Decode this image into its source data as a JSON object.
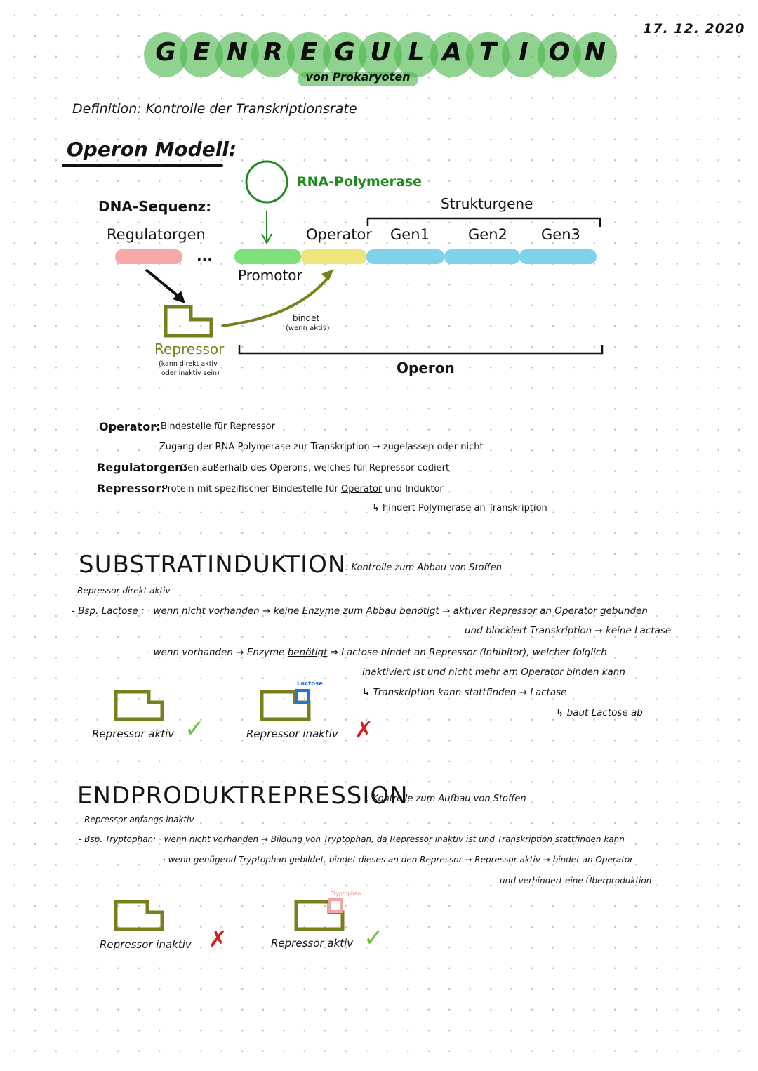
{
  "date": "17. 12. 2020",
  "title": {
    "letters": [
      "G",
      "E",
      "N",
      "R",
      "E",
      "G",
      "U",
      "L",
      "A",
      "T",
      "I",
      "O",
      "N"
    ],
    "subtitle": "von Prokaryoten",
    "accent_color": "#4cb64c"
  },
  "definition": "Definition: Kontrolle der Transkriptionsrate",
  "operon_model": {
    "heading": "Operon Modell:",
    "dna_label": "DNA-Sequenz:",
    "rna_polymerase": "RNA-Polymerase",
    "strukturgene": "Strukturgene",
    "segments": [
      {
        "label": "Regulatorgen",
        "color": "#f7a9a9"
      },
      {
        "label": "Promotor",
        "color": "#7ee07a"
      },
      {
        "label": "Operator",
        "color": "#ede57a"
      },
      {
        "label": "Gen1",
        "color": "#7ed2ea"
      },
      {
        "label": "Gen2",
        "color": "#7ed2ea"
      },
      {
        "label": "Gen3",
        "color": "#7ed2ea"
      }
    ],
    "ellipsis": "...",
    "bindet": "bindet",
    "wenn_aktiv": "(wenn aktiv)",
    "repressor": "Repressor",
    "repressor_note_1": "(kann direkt aktiv",
    "repressor_note_2": "oder inaktiv sein)",
    "operon": "Operon",
    "repressor_color": "#7a7f1b"
  },
  "glossary": {
    "operator_key": "Operator:",
    "operator_line1": "- Bindestelle für Repressor",
    "operator_line2": "- Zugang der RNA-Polymerase zur Transkription → zugelassen oder nicht",
    "regulatorgen_key": "Regulatorgen:",
    "regulatorgen_text": "Gen außerhalb des Operons, welches für Repressor codiert",
    "repressor_key": "Repressor:",
    "repressor_text_a": "Protein mit spezifischer Bindestelle für",
    "repressor_text_operator": "Operator",
    "repressor_text_b": "und Induktor",
    "repressor_sub": "↳ hindert Polymerase an Transkription"
  },
  "substratinduktion": {
    "title": "SUBSTRATINDUKTION",
    "subtitle": ": Kontrolle zum Abbau von Stoffen",
    "line1": "- Repressor direkt aktiv",
    "line2_a": "- Bsp. Lactose :  · wenn nicht vorhanden →",
    "line2_keine": "keine",
    "line2_b": "Enzyme zum Abbau benötigt ⇒ aktiver Repressor an Operator gebunden",
    "line3": "und blockiert Transkription → keine Lactase",
    "line4_a": "· wenn vorhanden → Enzyme",
    "line4_benoetigt": "benötigt",
    "line4_b": "⇒  Lactose bindet an Repressor (Inhibitor), welcher folglich",
    "line5": "inaktiviert ist und nicht mehr am Operator binden kann",
    "line6": "↳ Transkription kann stattfinden → Lactase",
    "line7": "↳ baut Lactose ab",
    "lactose_tag": "Lactose",
    "caption_active": "Repressor aktiv",
    "caption_inactive": "Repressor inaktiv",
    "check": "✓",
    "cross": "✗",
    "lactose_color": "#2476d6"
  },
  "endproduktrepression": {
    "title": "ENDPRODUKTREPRESSION",
    "subtitle": ": Kontrolle zum Aufbau von Stoffen",
    "line1": "- Repressor anfangs inaktiv",
    "line2": "- Bsp. Tryptophan:  · wenn nicht vorhanden → Bildung von Tryptophan, da Repressor inaktiv ist und Transkription stattfinden kann",
    "line3": "· wenn genügend Tryptophan gebildet, bindet dieses an den Repressor → Repressor aktiv → bindet an Operator",
    "line4": "und verhindert eine Überproduktion",
    "tryptophan_tag": "Tryptophan",
    "caption_inactive": "Repressor inaktiv",
    "caption_active": "Repressor aktiv",
    "check": "✓",
    "cross": "✗",
    "tryptophan_color": "#f2a7a2"
  }
}
